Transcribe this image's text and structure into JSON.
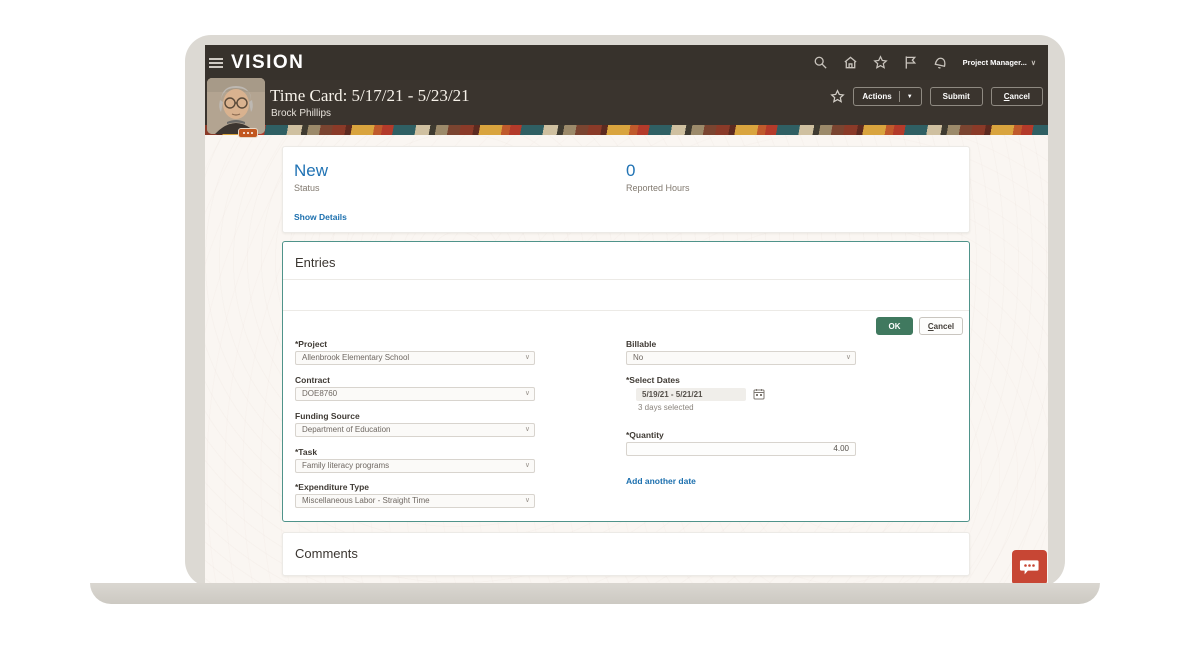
{
  "topbar": {
    "brand": "VISION",
    "user_menu": "Project Manager...",
    "user_menu_chevron": "∨"
  },
  "header": {
    "title": "Time Card: 5/17/21 - 5/23/21",
    "subtitle": "Brock Phillips",
    "actions_label": "Actions",
    "actions_arrow": "▼",
    "submit_label": "Submit",
    "cancel_label": "Cancel"
  },
  "summary": {
    "status_value": "New",
    "status_label": "Status",
    "hours_value": "0",
    "hours_label": "Reported Hours",
    "show_details_label": "Show Details"
  },
  "entries": {
    "title": "Entries",
    "ok_label": "OK",
    "cancel_label": "Cancel",
    "fields_left": [
      {
        "label": "*Project",
        "value": "Allenbrook Elementary School"
      },
      {
        "label": "Contract",
        "value": "DOE8760"
      },
      {
        "label": "Funding Source",
        "value": "Department of Education"
      },
      {
        "label": "*Task",
        "value": "Family literacy programs"
      },
      {
        "label": "*Expenditure Type",
        "value": "Miscellaneous Labor - Straight Time"
      }
    ],
    "billable": {
      "label": "Billable",
      "value": "No"
    },
    "select_dates": {
      "label": "*Select Dates",
      "value": "5/19/21 - 5/21/21",
      "note": "3 days selected"
    },
    "quantity": {
      "label": "*Quantity",
      "value": "4.00"
    },
    "add_date_link": "Add another date",
    "chevron": "∨"
  },
  "comments": {
    "title": "Comments"
  },
  "colors": {
    "header_dark": "#37322c",
    "accent_blue": "#2173b4",
    "entries_border_teal": "#4f938a",
    "ok_green": "#40795f",
    "chat_red": "#c74634",
    "strip_palette": [
      "#8a3a28",
      "#5c2a20",
      "#d9a43e",
      "#c05a2c",
      "#b43a2a",
      "#2f5f63",
      "#cfc0a0",
      "#3e3a30",
      "#9c8a6a",
      "#7a4430"
    ]
  }
}
